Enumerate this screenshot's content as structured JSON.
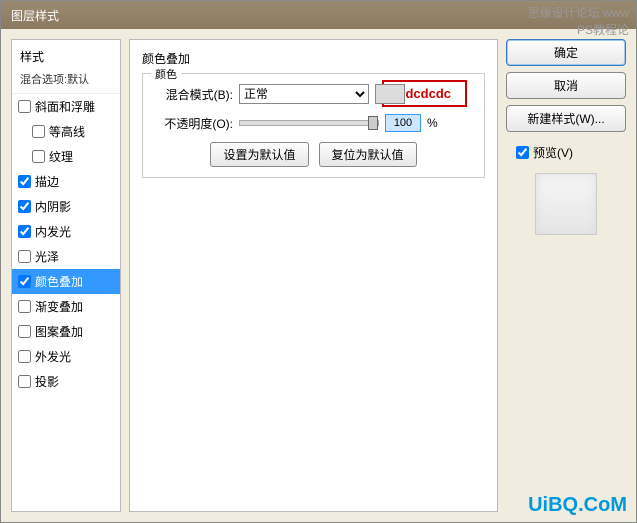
{
  "window_title": "图层样式",
  "watermark_top": "思缘设计论坛 www",
  "watermark_top2": "PS教程论",
  "watermark_bottom": "UiBQ.CoM",
  "left": {
    "header": "样式",
    "sub": "混合选项:默认",
    "items": [
      {
        "label": "斜面和浮雕",
        "checked": false
      },
      {
        "label": "等高线",
        "checked": false,
        "indent": true
      },
      {
        "label": "纹理",
        "checked": false,
        "indent": true
      },
      {
        "label": "描边",
        "checked": true
      },
      {
        "label": "内阴影",
        "checked": true
      },
      {
        "label": "内发光",
        "checked": true
      },
      {
        "label": "光泽",
        "checked": false
      },
      {
        "label": "颜色叠加",
        "checked": true,
        "selected": true
      },
      {
        "label": "渐变叠加",
        "checked": false
      },
      {
        "label": "图案叠加",
        "checked": false
      },
      {
        "label": "外发光",
        "checked": false
      },
      {
        "label": "投影",
        "checked": false
      }
    ]
  },
  "center": {
    "title": "颜色叠加",
    "fieldset_legend": "颜色",
    "blend_label": "混合模式(B):",
    "blend_value": "正常",
    "opacity_label": "不透明度(O):",
    "opacity_value": "100",
    "opacity_unit": "%",
    "default_btn": "设置为默认值",
    "reset_btn": "复位为默认值",
    "annotation": "#dcdcdc"
  },
  "right": {
    "ok": "确定",
    "cancel": "取消",
    "new_style": "新建样式(W)...",
    "preview_label": "预览(V)"
  }
}
